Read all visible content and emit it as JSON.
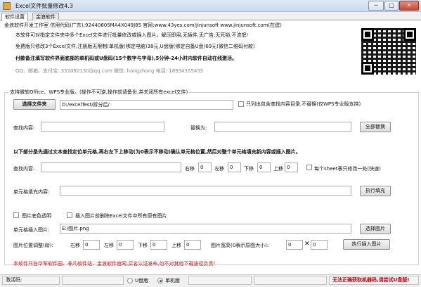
{
  "window": {
    "title": "Excel文件批量修改4.3",
    "minimize": "─",
    "maximize": "□",
    "close": "✕"
  },
  "tabs": [
    "软件设置",
    "金浪软件"
  ],
  "info": {
    "line1": "金浪软件开发工作室 信用代码(广东):92440605MA4X049J85 官网:www.43yes.com/jinjunsoft  www.jinjunsoft.com(在建)",
    "line2": "本软件可对指定文件夹中多个Excel文件进行批量修改或插入图片。解压即用,无插件,无广告,无死锁,不流氓!",
    "line3": "免费版只修改3个Excel文件,注册版无限制!单机版(绑定电脑)38元,U盘版(绑定自备U盘)69元!微信二维码付款!",
    "line4": "付款备注填写软件界面底部的单机码或U盘码(15个数字与字母),5分钟-24小时内软件自动在线激活。",
    "contact": "QQ、邮箱、支付宝: 332092130@qq.com        微信: hangzhong      电话: 18934355455"
  },
  "support_label": "支持微软Office、WPS专业版。(操作不可逆,操作前请备份,并关闭所有excel文件)",
  "folder": {
    "button": "选择文件夹",
    "path": "D:/excelTest/拆分后/",
    "subdir_label": "只列出包含查找内容目录,不替换(仅WPS专业版支持)"
  },
  "find": {
    "find_label": "查找内容:",
    "replace_label": "替换为:",
    "replace_all": "全部替换",
    "find_value": "",
    "replace_value": ""
  },
  "locate_note": "以下部分是先通过文本查找定位单元格,再右左下上移动(为0表示不移动)确认单元格位置,然后对整个单元格填充新内容或插入图片。",
  "offset_row": {
    "find_label": "查找内容:",
    "right_label": "右移",
    "right": "0",
    "left_label": "左移",
    "left": "0",
    "down_label": "下移",
    "down": "0",
    "up_label": "上移",
    "up": "0",
    "each_sheet_label": "每个sheet表只修改一处(快速)"
  },
  "fill": {
    "label": "单元格填充内容:",
    "value": "",
    "button": "执行填充"
  },
  "image": {
    "transparent_label": "图片底色透明",
    "delete_label": "插入图片前删除Excel文件中所有原有图片",
    "insert_label": "单元格插入图片:",
    "path": "E:/图片.png",
    "choose_button": "选择图片"
  },
  "position": {
    "label": "图片位置调整(磅):",
    "right_label": "右移",
    "right": "0",
    "left_label": "左移",
    "left": "0",
    "down_label": "下移",
    "down": "0",
    "up_label": "上移",
    "up": "0",
    "size_label": "图片宽高(0表示原图大小):",
    "width": "0",
    "times": "✕",
    "height": "0",
    "button": "执行插入图片"
  },
  "footer_note": "本软件只在华军软件园、非凡软件站、金浪软件官网,买名认证发布,勿不对其他下载途径负责!",
  "status": {
    "activation_code": "激活码:",
    "usb_label": "U盘版",
    "single_label": "单机版",
    "error": "无法正确获取机器码,请尝试U盘版!"
  },
  "colors": {
    "accent_red": "#d01010",
    "window_bg": "#ffffff",
    "titlebar": "#c9dbee"
  },
  "icons": {
    "app": "excel-app-icon",
    "qr": "qr-code-icon"
  }
}
